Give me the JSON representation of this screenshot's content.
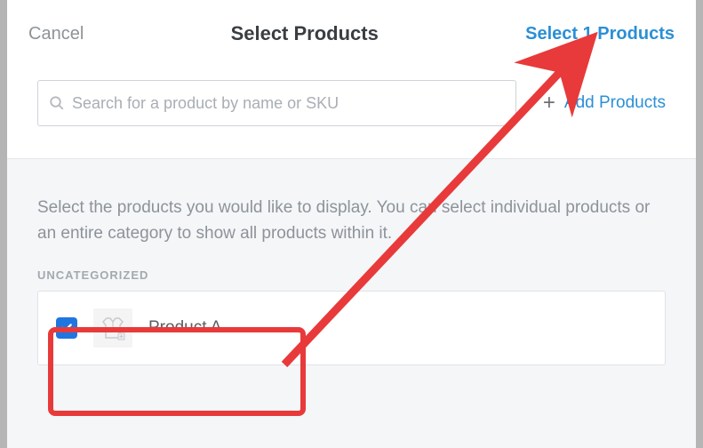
{
  "header": {
    "cancel": "Cancel",
    "title": "Select Products",
    "confirm": "Select 1 Products"
  },
  "search": {
    "placeholder": "Search for a product by name or SKU",
    "add_label": "Add Products"
  },
  "content": {
    "instructions": "Select the products you would like to display. You can select individual products or an entire category to show all products within it.",
    "category": "UNCATEGORIZED"
  },
  "products": [
    {
      "name": "Product A",
      "checked": true
    }
  ]
}
